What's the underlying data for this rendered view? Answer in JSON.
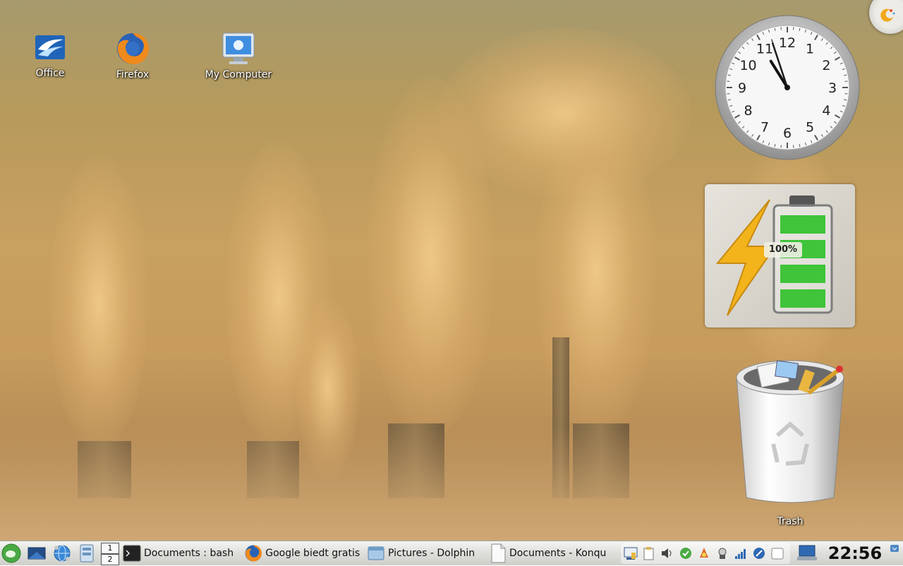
{
  "desktop_icons": [
    {
      "label": "Office",
      "icon": "office-icon"
    },
    {
      "label": "Firefox",
      "icon": "firefox-icon"
    },
    {
      "label": "My Computer",
      "icon": "computer-icon"
    }
  ],
  "clock": {
    "numbers": [
      "12",
      "1",
      "2",
      "3",
      "4",
      "5",
      "6",
      "7",
      "8",
      "9",
      "10",
      "11"
    ],
    "hour": 10,
    "minute": 56,
    "second": 57
  },
  "battery": {
    "percent_label": "100%",
    "level": 1.0
  },
  "trash": {
    "label": "Trash"
  },
  "panel": {
    "tasks": [
      {
        "label": "Documents : bash",
        "icon": "terminal-icon"
      },
      {
        "label": "Google biedt gratis t",
        "icon": "firefox-icon"
      },
      {
        "label": "Pictures - Dolphin",
        "icon": "dolphin-icon"
      },
      {
        "label": "Documents - Konqu",
        "icon": "konqueror-icon"
      }
    ],
    "pager": [
      "1",
      "2"
    ],
    "time": "22:56"
  },
  "colors": {
    "panel": "#dededa",
    "battery_green": "#3fc43a",
    "lightning": "#f2b31b"
  }
}
